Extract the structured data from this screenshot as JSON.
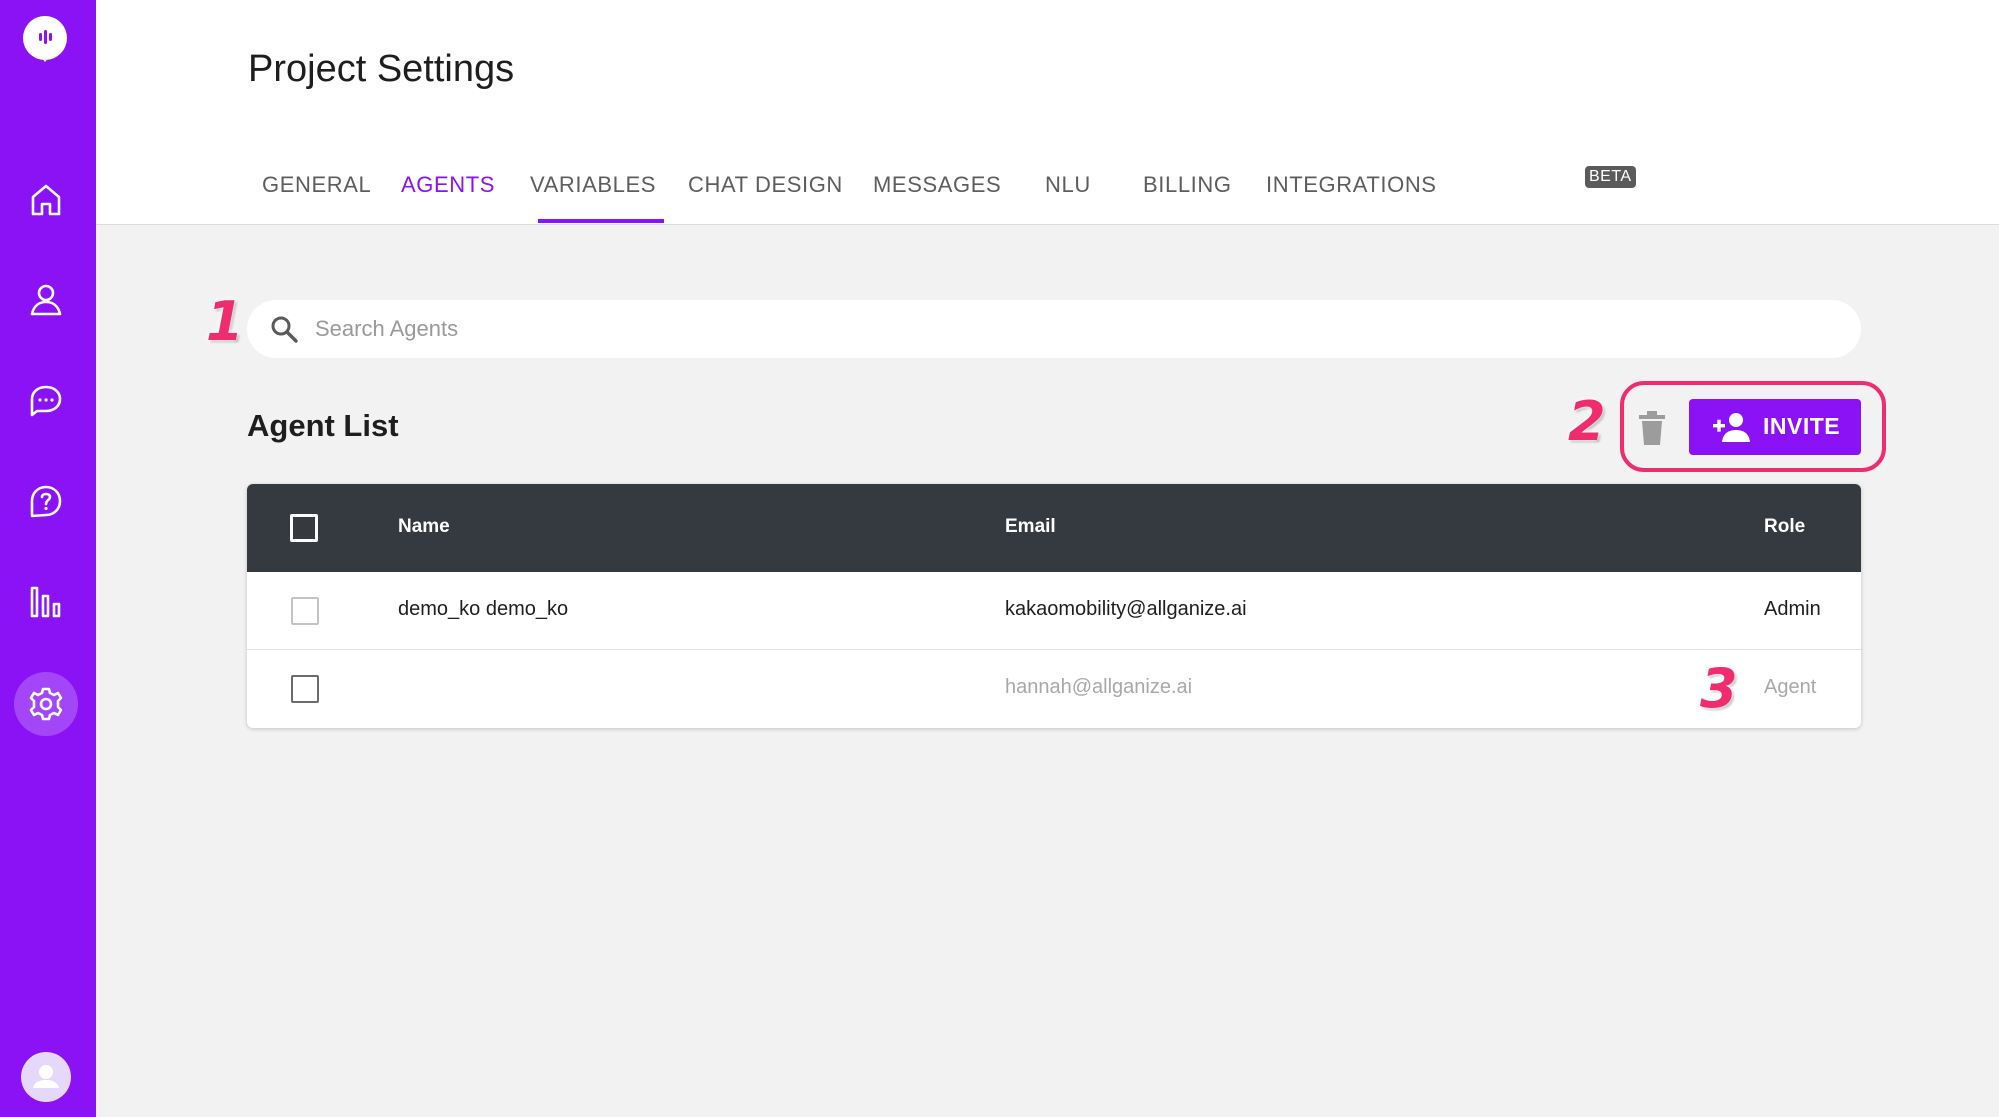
{
  "page": {
    "title": "Project Settings"
  },
  "tabs": [
    {
      "label": "GENERAL"
    },
    {
      "label": "AGENTS"
    },
    {
      "label": "VARIABLES"
    },
    {
      "label": "CHAT DESIGN"
    },
    {
      "label": "MESSAGES"
    },
    {
      "label": "NLU"
    },
    {
      "label": "BILLING"
    },
    {
      "label": "INTEGRATIONS"
    }
  ],
  "active_tab": "AGENTS",
  "integrations_badge": "BETA",
  "search": {
    "placeholder": "Search Agents",
    "value": ""
  },
  "agent_list": {
    "title": "Agent List",
    "invite_label": "INVITE",
    "columns": {
      "name": "Name",
      "email": "Email",
      "role": "Role"
    },
    "rows": [
      {
        "name": "demo_ko demo_ko",
        "email": "kakaomobility@allganize.ai",
        "role": "Admin"
      },
      {
        "name": "",
        "email": "hannah@allganize.ai",
        "role": "Agent"
      }
    ]
  },
  "annotations": {
    "a1": "1",
    "a2": "2",
    "a3": "3"
  },
  "colors": {
    "brand": "#8a12f5",
    "annotation": "#ef2d6e",
    "table_header": "#353a41"
  },
  "sidebar_icons": [
    "home-icon",
    "user-icon",
    "chat-icon",
    "help-icon",
    "analytics-icon",
    "settings-icon"
  ]
}
